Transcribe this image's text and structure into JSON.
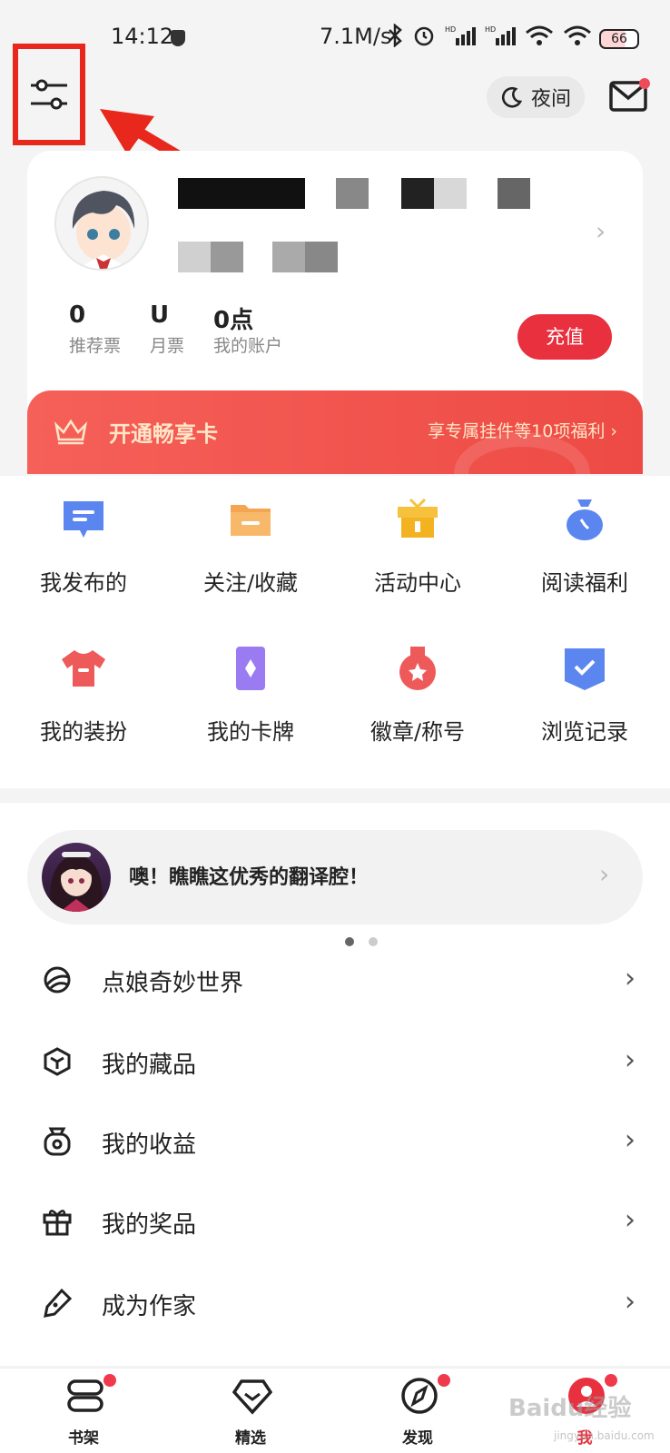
{
  "status_bar": {
    "time": "14:12",
    "speed": "7.1M/s",
    "battery": "66"
  },
  "header": {
    "night_label": "夜间"
  },
  "profile": {
    "stats": [
      {
        "value": "0",
        "label": "推荐票"
      },
      {
        "value": "U",
        "label": "月票"
      },
      {
        "value": "0点",
        "label": "我的账户"
      }
    ],
    "recharge_label": "充值"
  },
  "vip_banner": {
    "title": "开通畅享卡",
    "description": "享专属挂件等10项福利 ›"
  },
  "grid": [
    {
      "label": "我发布的",
      "icon": "message-icon",
      "color": "#5b86f0"
    },
    {
      "label": "关注/收藏",
      "icon": "folder-icon",
      "color": "#f4a552"
    },
    {
      "label": "活动中心",
      "icon": "gift-icon",
      "color": "#f6c13c"
    },
    {
      "label": "阅读福利",
      "icon": "money-bag-icon",
      "color": "#5b86f0"
    },
    {
      "label": "我的装扮",
      "icon": "tshirt-icon",
      "color": "#ee5a5a"
    },
    {
      "label": "我的卡牌",
      "icon": "card-icon",
      "color": "#9a7bf2"
    },
    {
      "label": "徽章/称号",
      "icon": "medal-icon",
      "color": "#ee5a5a"
    },
    {
      "label": "浏览记录",
      "icon": "history-icon",
      "color": "#5b86f0"
    }
  ],
  "promo": {
    "text": "噢！瞧瞧这优秀的翻译腔！"
  },
  "menu": [
    {
      "label": "点娘奇妙世界",
      "icon": "world-icon"
    },
    {
      "label": "我的藏品",
      "icon": "cube-icon"
    },
    {
      "label": "我的收益",
      "icon": "earnings-icon"
    },
    {
      "label": "我的奖品",
      "icon": "prize-icon"
    },
    {
      "label": "成为作家",
      "icon": "pen-icon"
    }
  ],
  "bottom_nav": [
    {
      "label": "书架",
      "icon": "bookshelf-icon",
      "badge": true
    },
    {
      "label": "精选",
      "icon": "diamond-icon",
      "badge": false
    },
    {
      "label": "发现",
      "icon": "compass-icon",
      "badge": true
    },
    {
      "label": "我",
      "icon": "profile-icon",
      "badge": true
    }
  ],
  "watermark": {
    "brand": "Baidu经验",
    "url": "jingyan.baidu.com"
  },
  "colors": {
    "accent": "#e8303f",
    "annotation": "#e8281c"
  }
}
